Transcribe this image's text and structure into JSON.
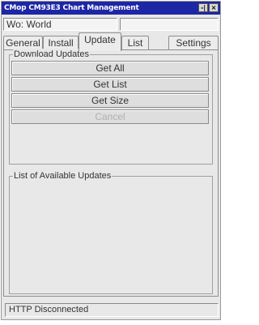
{
  "window": {
    "title": "CMop CM93E3 Chart Management",
    "title_buttons": [
      "-|",
      "×"
    ]
  },
  "fields": {
    "wo_value": "Wo: World",
    "secondary_value": ""
  },
  "tabs": [
    {
      "label": "General",
      "active": false
    },
    {
      "label": "Install",
      "active": false
    },
    {
      "label": "Update",
      "active": true
    },
    {
      "label": "List",
      "active": false
    },
    {
      "label": "Settings",
      "active": false
    }
  ],
  "download_updates": {
    "legend": "Download Updates",
    "buttons": [
      {
        "label": "Get All",
        "enabled": true
      },
      {
        "label": "Get List",
        "enabled": true
      },
      {
        "label": "Get Size",
        "enabled": true
      },
      {
        "label": "Cancel",
        "enabled": false
      }
    ]
  },
  "available_updates": {
    "legend": "List of Available Updates"
  },
  "status": {
    "text": "HTTP Disconnected"
  }
}
